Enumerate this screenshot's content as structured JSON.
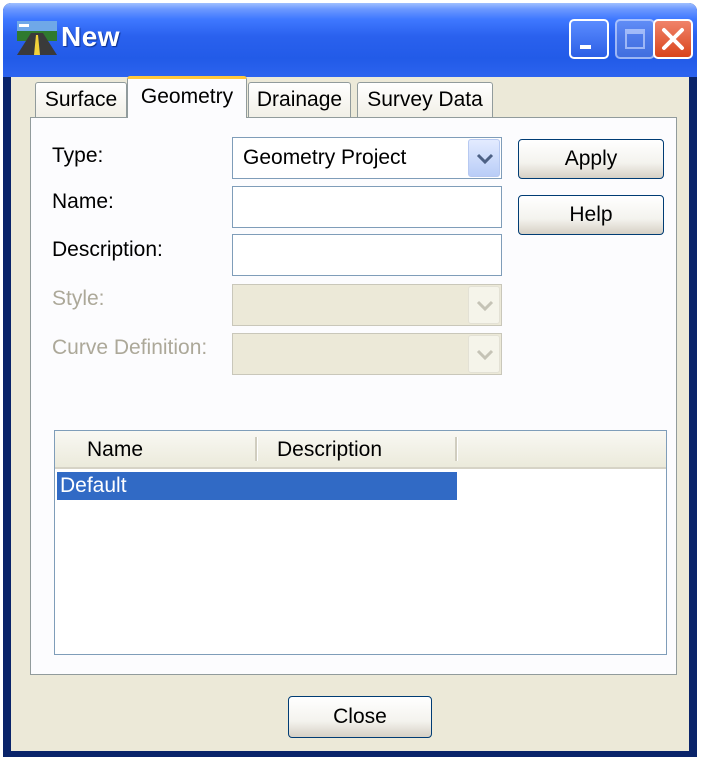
{
  "window": {
    "title": "New",
    "icons": {
      "app": "road-app-icon",
      "minimize": "minimize-icon",
      "maximize": "maximize-icon",
      "close": "close-x-icon"
    }
  },
  "tabs": [
    {
      "label": "Surface",
      "active": false
    },
    {
      "label": "Geometry",
      "active": true
    },
    {
      "label": "Drainage",
      "active": false
    },
    {
      "label": "Survey Data",
      "active": false
    }
  ],
  "form": {
    "type": {
      "label": "Type:",
      "value": "Geometry Project"
    },
    "name": {
      "label": "Name:",
      "value": ""
    },
    "description": {
      "label": "Description:",
      "value": ""
    },
    "style": {
      "label": "Style:",
      "value": "",
      "disabled": true
    },
    "curve_definition": {
      "label": "Curve Definition:",
      "value": "",
      "disabled": true
    }
  },
  "buttons": {
    "apply": "Apply",
    "help": "Help",
    "close": "Close"
  },
  "list": {
    "columns": [
      "Name",
      "Description"
    ],
    "rows": [
      {
        "name": "Default",
        "description": "",
        "selected": true
      }
    ]
  },
  "colors": {
    "titlebar": "#2a61ee",
    "selection": "#316ac5",
    "tab_highlight": "#ffc83c",
    "face": "#ece9d8"
  }
}
